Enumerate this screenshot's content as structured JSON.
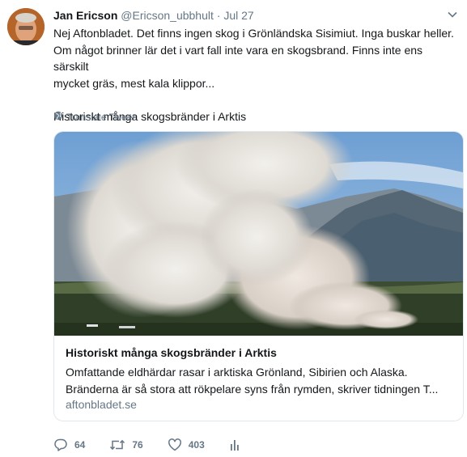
{
  "tweet": {
    "author_name": "Jan Ericson",
    "author_handle": "@Ericson_ubbhult",
    "separator": "·",
    "timestamp": "Jul 27",
    "text": "Nej Aftonbladet. Det finns ingen skog i Grönländska Sisimiut. Inga buskar heller.\nOm något brinner lär det i vart fall inte vara en skogsbrand. Finns inte ens särskilt\nmycket gräs, mest kala klippor...\n\nHistoriskt många skogsbränder i Arktis",
    "translate_label": "Translate Tweet"
  },
  "card": {
    "title": "Historiskt många skogsbränder i Arktis",
    "description_line1": "Omfattande eldhärdar rasar i arktiska Grönland, Sibirien och Alaska.",
    "description_line2": "Bränderna är så stora att rökpelare syns från rymden, skriver tidningen T...",
    "domain": "aftonbladet.se"
  },
  "actions": {
    "replies": "64",
    "retweets": "76",
    "likes": "403"
  },
  "icons": {
    "caret": "chevron-down-icon",
    "globe": "globe-icon",
    "reply": "reply-icon",
    "retweet": "retweet-icon",
    "like": "heart-icon",
    "analytics": "analytics-icon"
  },
  "colors": {
    "text": "#14171a",
    "secondary": "#657786",
    "border": "#e1e8ed"
  }
}
